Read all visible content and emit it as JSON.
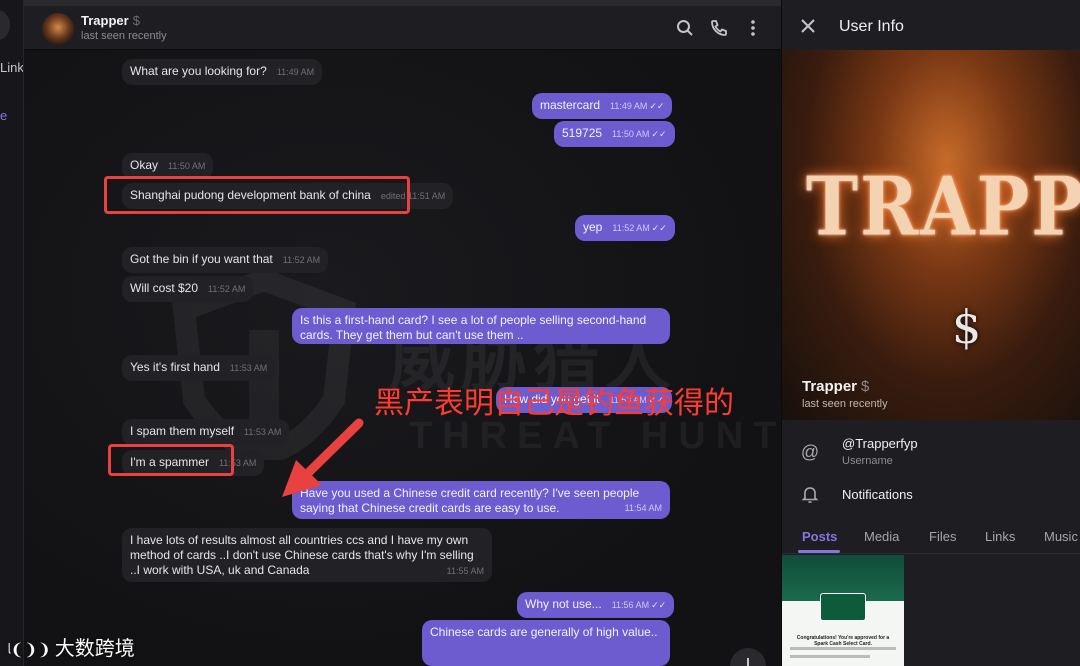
{
  "colors": {
    "accent": "#8774e1",
    "outgoing_bubble": "#6d5bd0",
    "incoming_bubble": "#222226",
    "highlight_red": "#e8413f"
  },
  "sidebar": {
    "frag_link": "Link",
    "frag_e": "e"
  },
  "chat": {
    "title": "Trapper",
    "title_symbol": "$",
    "status": "last seen recently",
    "icons": [
      "search-icon",
      "phone-icon",
      "more-vertical-icon"
    ]
  },
  "messages": [
    {
      "dir": "in",
      "text": "What are you looking for?",
      "time": "11:49 AM"
    },
    {
      "dir": "out",
      "text": "mastercard",
      "time": "11:49 AM"
    },
    {
      "dir": "out",
      "text": "519725",
      "time": "11:50 AM"
    },
    {
      "dir": "in",
      "text": "Okay",
      "time": "11:50 AM"
    },
    {
      "dir": "in",
      "text": "Shanghai pudong development bank of china",
      "time": "edited 11:51 AM"
    },
    {
      "dir": "out",
      "text": "yep",
      "time": "11:52 AM"
    },
    {
      "dir": "in",
      "text": "Got the bin if you want that",
      "time": "11:52 AM"
    },
    {
      "dir": "in",
      "text": "Will cost $20",
      "time": "11:52 AM"
    },
    {
      "dir": "out",
      "text": "Is this a first-hand card? I see a lot of people selling second-hand cards. They get them but can't use them ..",
      "time": ""
    },
    {
      "dir": "in",
      "text": "Yes it's first hand",
      "time": "11:53 AM"
    },
    {
      "dir": "out",
      "text": "How did you get it",
      "time": "11:53 AM"
    },
    {
      "dir": "in",
      "text": "I spam them myself",
      "time": "11:53 AM"
    },
    {
      "dir": "in",
      "text": "I'm a spammer",
      "time": "11:53 AM"
    },
    {
      "dir": "out",
      "text": "Have you used a Chinese credit card recently? I've seen people saying that Chinese credit cards are easy to use.",
      "time": "11:54 AM"
    },
    {
      "dir": "in",
      "text": "I have lots of results almost all countries ccs and I have my own method of cards ..I don't use Chinese cards that's why I'm selling ..I work with USA, uk and Canada",
      "time": "11:55 AM"
    },
    {
      "dir": "out",
      "text": "Why not use...",
      "time": "11:56 AM"
    },
    {
      "dir": "out",
      "text": "Chinese cards are generally of high value..",
      "time": ""
    }
  ],
  "overlay": {
    "annotation": "黑产表明自己是钓鱼获得的",
    "watermark": "威胁猎人",
    "watermark_sub": "THREAT HUNTER",
    "brand": "大数跨境"
  },
  "user_info": {
    "title": "User Info",
    "name": "Trapper",
    "name_symbol": "$",
    "status": "last seen recently",
    "cover_text": "TRAPPER",
    "cover_symbol": "$",
    "username": "@Trapperfyp",
    "username_label": "Username",
    "notifications_label": "Notifications",
    "tabs": [
      "Posts",
      "Media",
      "Files",
      "Links",
      "Music"
    ],
    "active_tab": "Posts",
    "post_text": "Congratulations! You're approved for a Spark Cash Select Card."
  }
}
